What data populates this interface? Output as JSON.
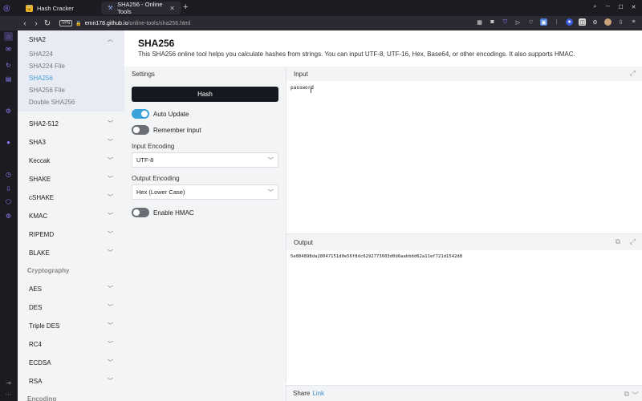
{
  "browser": {
    "tabs": [
      {
        "title": "Hash Cracker",
        "active": false
      },
      {
        "title": "SHA256 - Online Tools",
        "active": true
      }
    ],
    "url_host": "emn178.github.io",
    "url_path": "/online-tools/sha256.html",
    "vpn_label": "VPN"
  },
  "sidenav": {
    "open_group": {
      "label": "SHA2",
      "items": [
        "SHA224",
        "SHA224 File",
        "SHA256",
        "SHA256 File",
        "Double SHA256"
      ],
      "active_item": "SHA256"
    },
    "groups": [
      "SHA2-512",
      "SHA3",
      "Keccak",
      "SHAKE",
      "cSHAKE",
      "KMAC",
      "RIPEMD",
      "BLAKE"
    ],
    "category_crypto": "Cryptography",
    "crypto_groups": [
      "AES",
      "DES",
      "Triple DES",
      "RC4",
      "ECDSA",
      "RSA"
    ],
    "category_encoding": "Encoding"
  },
  "main": {
    "title": "SHA256",
    "description": "This SHA256 online tool helps you calculate hashes from strings. You can input UTF-8, UTF-16, Hex, Base64, or other encodings. It also supports HMAC."
  },
  "settings": {
    "header": "Settings",
    "hash_button": "Hash",
    "auto_update_label": "Auto Update",
    "auto_update_on": true,
    "remember_input_label": "Remember Input",
    "remember_input_on": false,
    "input_encoding_label": "Input Encoding",
    "input_encoding_value": "UTF-8",
    "output_encoding_label": "Output Encoding",
    "output_encoding_value": "Hex (Lower Case)",
    "hmac_label": "Enable HMAC",
    "hmac_on": false
  },
  "input": {
    "header": "Input",
    "value": "password"
  },
  "output": {
    "header": "Output",
    "value": "5e884898da28047151d0e56f8dc6292773603d0d6aabbdd62a11ef721d1542d8"
  },
  "share": {
    "label": "Share",
    "link_text": "Link"
  }
}
